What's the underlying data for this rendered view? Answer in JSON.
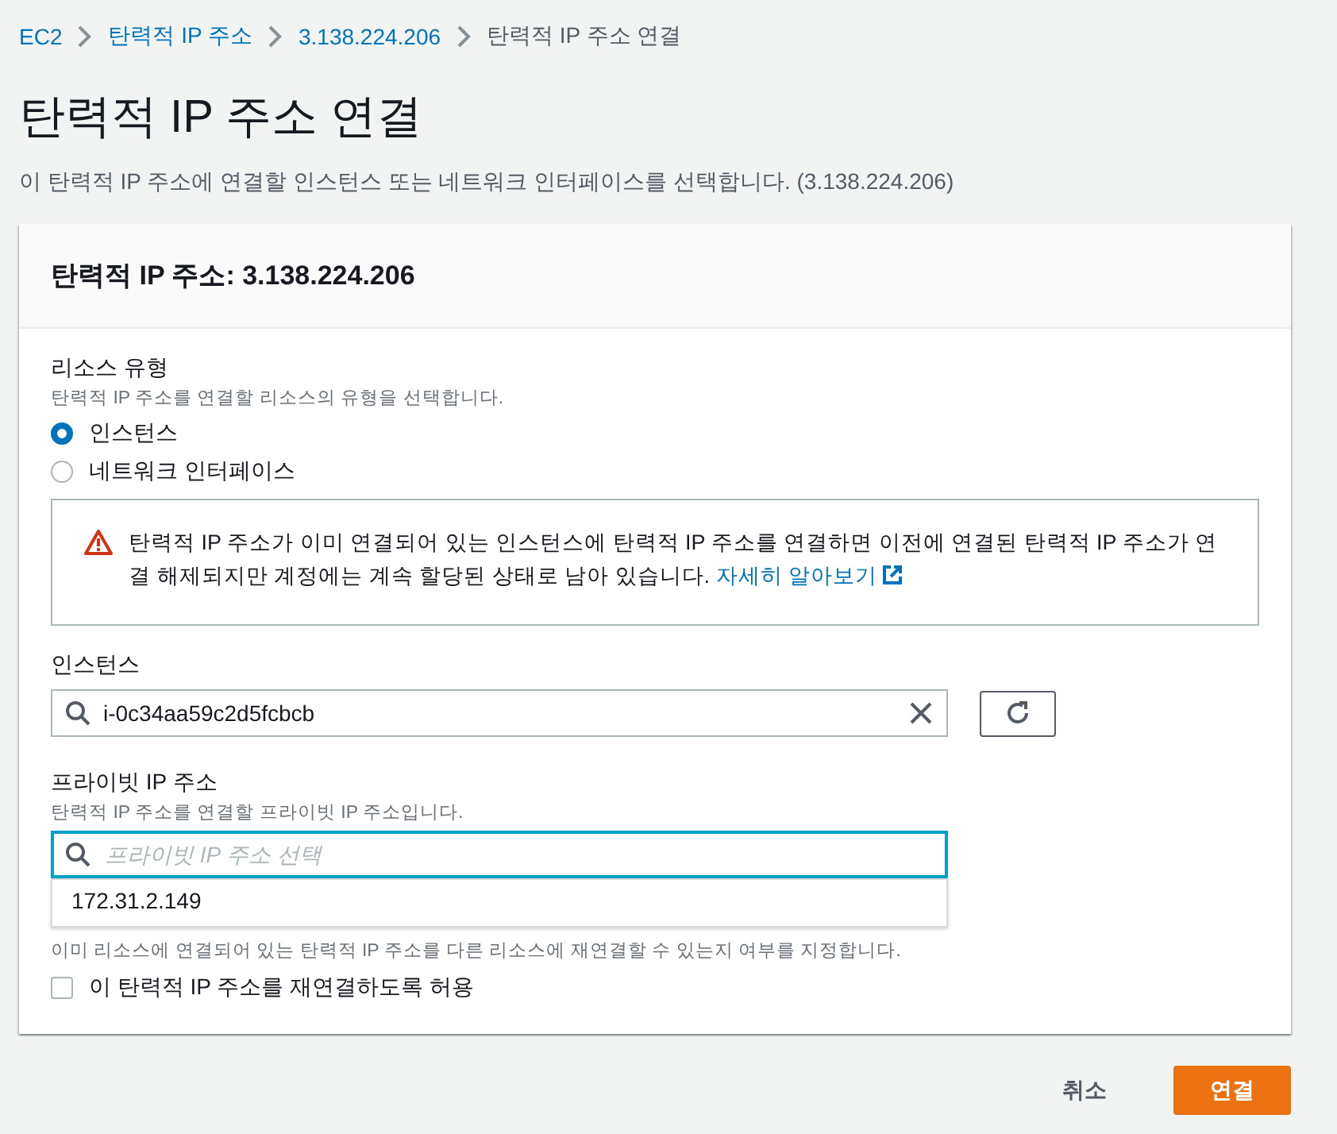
{
  "breadcrumb": [
    {
      "label": "EC2",
      "link": true
    },
    {
      "label": "탄력적 IP 주소",
      "link": true
    },
    {
      "label": "3.138.224.206",
      "link": true
    },
    {
      "label": "탄력적 IP 주소 연결",
      "link": false
    }
  ],
  "title": "탄력적 IP 주소 연결",
  "description": "이 탄력적 IP 주소에 연결할 인스턴스 또는 네트워크 인터페이스를 선택합니다. (3.138.224.206)",
  "panel": {
    "heading": "탄력적 IP 주소: 3.138.224.206",
    "resource_type": {
      "label": "리소스 유형",
      "hint": "탄력적 IP 주소를 연결할 리소스의 유형을 선택합니다.",
      "options": [
        {
          "label": "인스턴스",
          "selected": true
        },
        {
          "label": "네트워크 인터페이스",
          "selected": false
        }
      ]
    },
    "warning": {
      "text": "탄력적 IP 주소가 이미 연결되어 있는 인스턴스에 탄력적 IP 주소를 연결하면 이전에 연결된 탄력적 IP 주소가 연결 해제되지만 계정에는 계속 할당된 상태로 남아 있습니다.",
      "link": "자세히 알아보기"
    },
    "instance": {
      "label": "인스턴스",
      "value": "i-0c34aa59c2d5fcbcb"
    },
    "private_ip": {
      "label": "프라이빗 IP 주소",
      "hint": "탄력적 IP 주소를 연결할 프라이빗 IP 주소입니다.",
      "placeholder": "프라이빗 IP 주소 선택",
      "options": [
        "172.31.2.149"
      ]
    },
    "reassociation": {
      "hint": "이미 리소스에 연결되어 있는 탄력적 IP 주소를 다른 리소스에 재연결할 수 있는지 여부를 지정합니다.",
      "checkbox": {
        "label": "이 탄력적 IP 주소를 재연결하도록 허용",
        "checked": false
      }
    }
  },
  "buttons": [
    {
      "label": "취소",
      "kind": "link"
    },
    {
      "label": "연결",
      "kind": "primary"
    }
  ]
}
